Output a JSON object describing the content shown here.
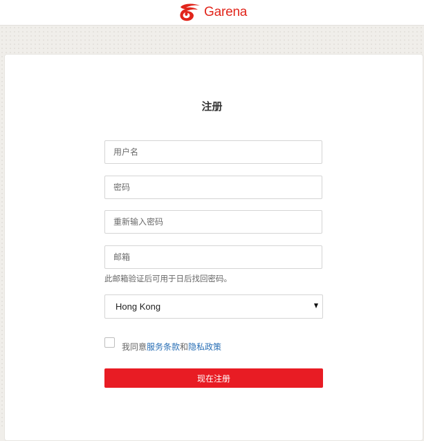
{
  "header": {
    "logo_text": "Garena",
    "logo_icon": "garena-dragon-icon",
    "brand_color": "#e1251b"
  },
  "form": {
    "title": "注册",
    "username_placeholder": "用户名",
    "password_placeholder": "密码",
    "confirm_password_placeholder": "重新输入密码",
    "email_placeholder": "邮箱",
    "email_hint": "此邮箱验证后可用于日后找回密码。",
    "region_selected": "Hong Kong",
    "agree_prefix": "我同意",
    "terms_link": "服务条款",
    "agree_and": "和",
    "privacy_link": "隐私政策",
    "submit_label": "现在注册",
    "button_color": "#e81c24",
    "link_color": "#2a6fb5"
  }
}
